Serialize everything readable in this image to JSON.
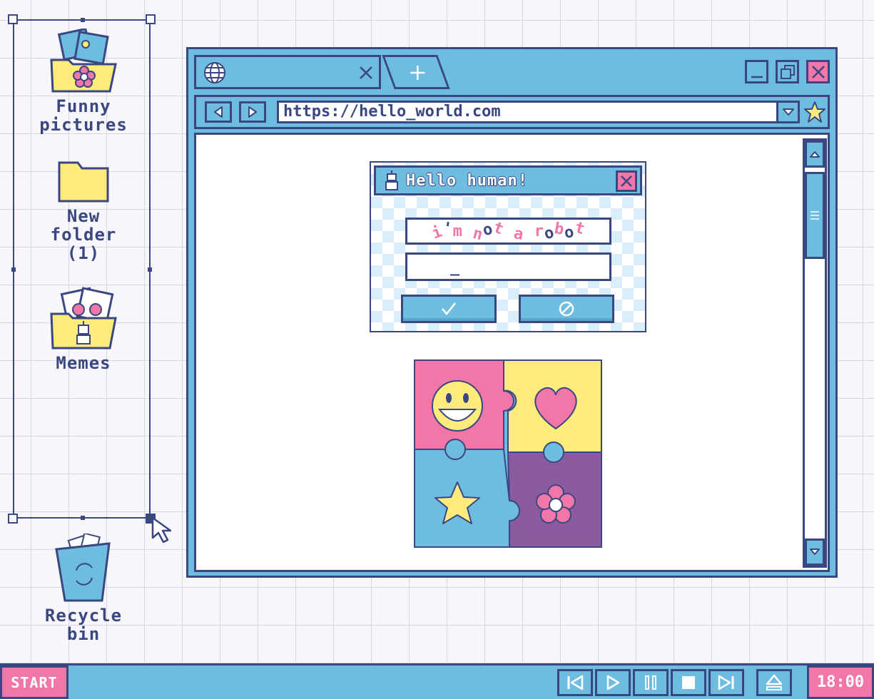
{
  "colors": {
    "accent_blue": "#6ebde0",
    "outline": "#3a4780",
    "pink": "#f077a8",
    "yellow": "#fdec7b",
    "purple": "#8a5b9e",
    "background": "#f7f7fb"
  },
  "desktop": {
    "icons": [
      {
        "label": "Funny\npictures",
        "icon": "photo-folder-icon"
      },
      {
        "label": "New\nfolder\n(1)",
        "icon": "folder-icon"
      },
      {
        "label": "Memes",
        "icon": "memes-folder-icon"
      },
      {
        "label": "Recycle\nbin",
        "icon": "recycle-bin-icon"
      }
    ]
  },
  "browser": {
    "tabs": [
      {
        "icon": "globe-icon",
        "close_icon": "close-icon"
      },
      {
        "icon": "plus-icon"
      }
    ],
    "window_controls": [
      "minimize-icon",
      "restore-icon",
      "close-icon"
    ],
    "nav": [
      "back-icon",
      "forward-icon"
    ],
    "url": "https://hello_world.com",
    "bookmark_icon": "star-icon"
  },
  "dialog": {
    "title": "Hello human!",
    "captcha_text": "i'm not a robot",
    "input_value": "_",
    "confirm_icon": "checkmark-icon",
    "cancel_icon": "prohibited-icon"
  },
  "taskbar": {
    "start_label": "START",
    "media_controls": [
      "skip-back-icon",
      "play-icon",
      "pause-icon",
      "stop-icon",
      "skip-forward-icon",
      "eject-icon"
    ],
    "clock": "18:00"
  }
}
